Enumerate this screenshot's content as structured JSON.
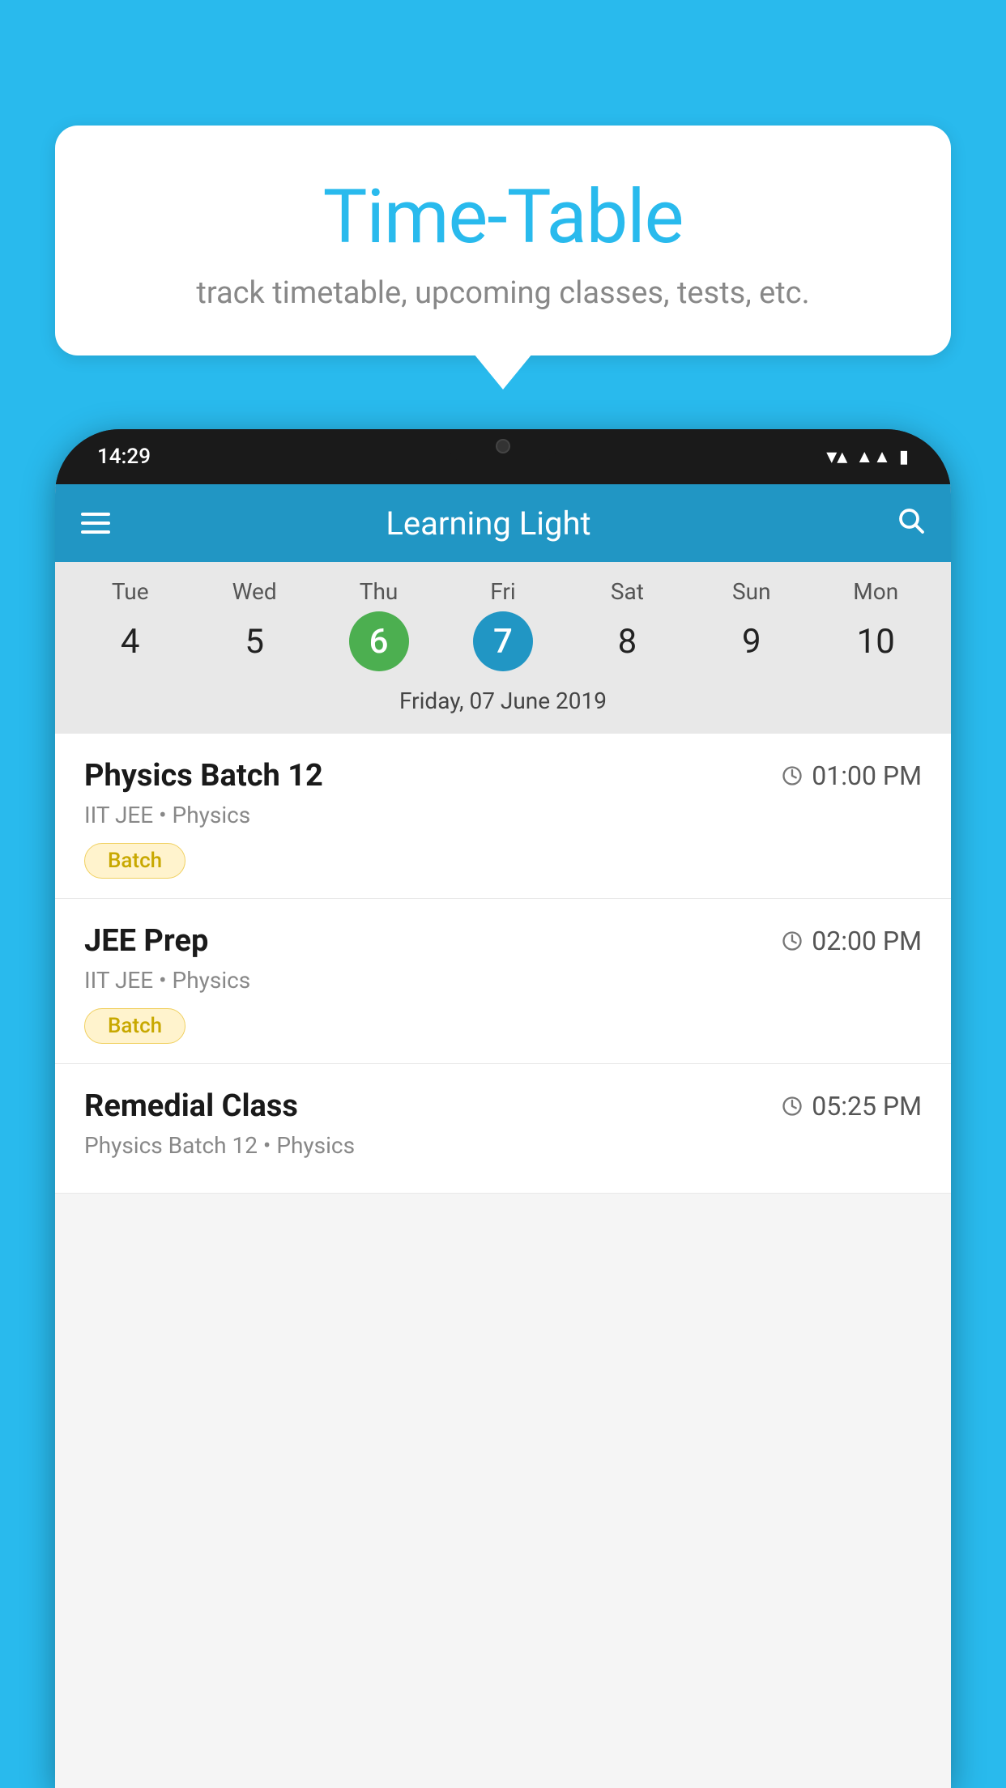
{
  "background_color": "#29BAED",
  "bubble": {
    "title": "Time-Table",
    "subtitle": "track timetable, upcoming classes, tests, etc."
  },
  "phone": {
    "status_time": "14:29",
    "app_title": "Learning Light",
    "calendar": {
      "days": [
        {
          "name": "Tue",
          "num": "4",
          "state": "normal"
        },
        {
          "name": "Wed",
          "num": "5",
          "state": "normal"
        },
        {
          "name": "Thu",
          "num": "6",
          "state": "today"
        },
        {
          "name": "Fri",
          "num": "7",
          "state": "selected"
        },
        {
          "name": "Sat",
          "num": "8",
          "state": "normal"
        },
        {
          "name": "Sun",
          "num": "9",
          "state": "normal"
        },
        {
          "name": "Mon",
          "num": "10",
          "state": "normal"
        }
      ],
      "selected_date_label": "Friday, 07 June 2019"
    },
    "schedule": [
      {
        "title": "Physics Batch 12",
        "time": "01:00 PM",
        "meta": "IIT JEE • Physics",
        "badge": "Batch"
      },
      {
        "title": "JEE Prep",
        "time": "02:00 PM",
        "meta": "IIT JEE • Physics",
        "badge": "Batch"
      },
      {
        "title": "Remedial Class",
        "time": "05:25 PM",
        "meta": "Physics Batch 12 • Physics",
        "badge": ""
      }
    ]
  }
}
